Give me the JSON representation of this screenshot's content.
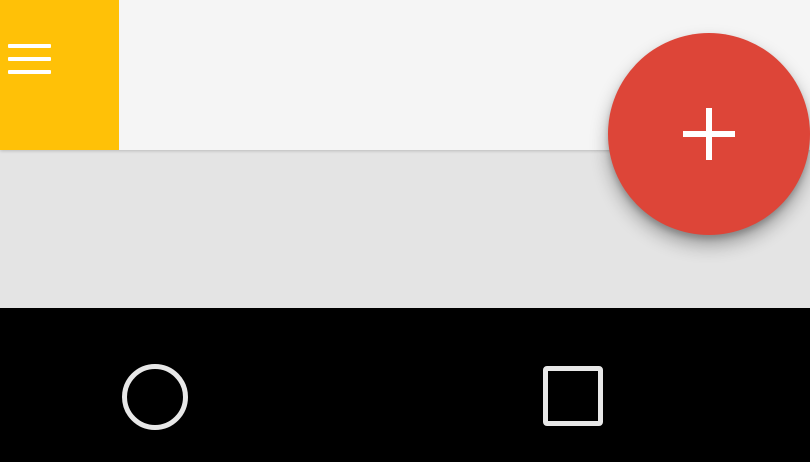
{
  "toolbar": {
    "menu_icon": "hamburger-menu-icon",
    "background": "#f5f5f5",
    "menu_block_color": "#ffc107"
  },
  "content": {
    "background": "#e4e4e4"
  },
  "fab": {
    "icon": "plus-icon",
    "color": "#dd4538"
  },
  "nav_bar": {
    "background": "#000000",
    "buttons": [
      {
        "icon": "home-circle-icon"
      },
      {
        "icon": "recents-square-icon"
      }
    ]
  }
}
